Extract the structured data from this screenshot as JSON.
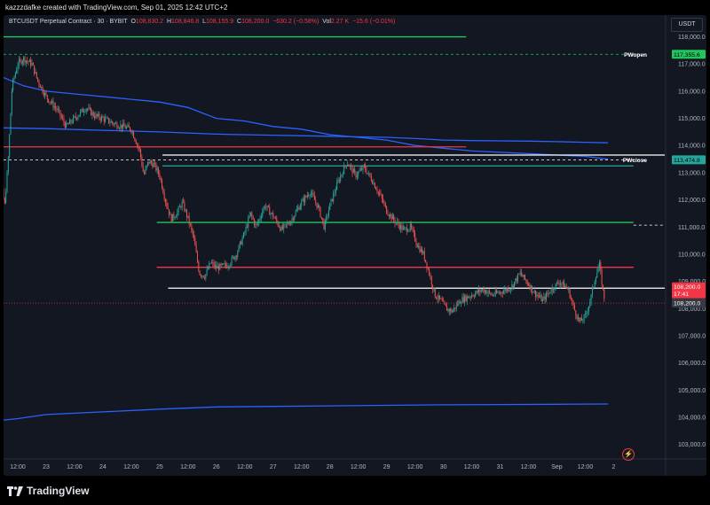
{
  "header": {
    "title": "kazzzdafke created with TradingView.com, Sep 01, 2025 12:42 UTC+2"
  },
  "legend": {
    "symbol": "BTCUSDT Perpetual Contract · 30 · BYBIT",
    "o_label": "O",
    "o": "108,830.2",
    "h_label": "H",
    "h": "108,846.8",
    "l_label": "L",
    "l": "108,155.9",
    "c_label": "C",
    "c": "108,200.0",
    "change": "−630.2 (−0.58%)",
    "vol_label": "Vol",
    "vol": "2.27 K",
    "vol_change": "−15.6 (−0.01%)"
  },
  "currency_button": "USDT",
  "footer": {
    "brand": "TradingView"
  },
  "colors": {
    "background": "#131722",
    "up": "#26a69a",
    "down": "#ef5350",
    "green_level": "#22c55e",
    "red_level": "#f23645",
    "blue_line": "#2962ff",
    "white_level": "#ffffff"
  },
  "chart_data": {
    "type": "candlestick",
    "interval": "30",
    "ylim": [
      102500,
      118800
    ],
    "y_ticks": [
      "118,000.0",
      "117,000.0",
      "116,000.0",
      "115,000.0",
      "114,000.0",
      "113,000.0",
      "112,000.0",
      "111,000.0",
      "110,000.0",
      "109,000.0",
      "108,000.0",
      "107,000.0",
      "106,000.0",
      "105,000.0",
      "104,000.0",
      "103,000.0"
    ],
    "y_tick_values": [
      118000,
      117000,
      116000,
      115000,
      114000,
      113000,
      112000,
      111000,
      110000,
      109000,
      108000,
      107000,
      106000,
      105000,
      104000,
      103000
    ],
    "x_ticks": [
      "12:00",
      "23",
      "12:00",
      "24",
      "12:00",
      "25",
      "12:00",
      "26",
      "12:00",
      "27",
      "12:00",
      "28",
      "12:00",
      "29",
      "12:00",
      "30",
      "12:00",
      "31",
      "12:00",
      "Sep",
      "12:00",
      "2"
    ],
    "x_range_days": [
      22.25,
      33.9
    ],
    "x_tick_values": [
      22.5,
      23,
      23.5,
      24,
      24.5,
      25,
      25.5,
      26,
      26.5,
      27,
      27.5,
      28,
      28.5,
      29,
      29.5,
      30,
      30.5,
      31,
      31.5,
      32,
      32.5,
      33
    ],
    "price_path": [
      [
        22.0,
        113500
      ],
      [
        22.1,
        113200
      ],
      [
        22.2,
        112600
      ],
      [
        22.27,
        111800
      ],
      [
        22.33,
        113400
      ],
      [
        22.4,
        116200
      ],
      [
        22.5,
        117000
      ],
      [
        22.6,
        117200
      ],
      [
        22.75,
        117000
      ],
      [
        22.85,
        116400
      ],
      [
        23.0,
        115800
      ],
      [
        23.2,
        115300
      ],
      [
        23.35,
        114700
      ],
      [
        23.5,
        115000
      ],
      [
        23.7,
        115400
      ],
      [
        23.85,
        115100
      ],
      [
        24.0,
        115000
      ],
      [
        24.2,
        114800
      ],
      [
        24.35,
        114700
      ],
      [
        24.5,
        114600
      ],
      [
        24.65,
        113800
      ],
      [
        24.72,
        112900
      ],
      [
        24.8,
        113400
      ],
      [
        24.9,
        113300
      ],
      [
        25.0,
        112900
      ],
      [
        25.1,
        112000
      ],
      [
        25.2,
        111300
      ],
      [
        25.3,
        111500
      ],
      [
        25.4,
        111900
      ],
      [
        25.5,
        111300
      ],
      [
        25.6,
        110600
      ],
      [
        25.7,
        109300
      ],
      [
        25.8,
        109200
      ],
      [
        25.9,
        109700
      ],
      [
        26.0,
        109500
      ],
      [
        26.2,
        109600
      ],
      [
        26.35,
        110000
      ],
      [
        26.5,
        110800
      ],
      [
        26.6,
        111500
      ],
      [
        26.7,
        111000
      ],
      [
        26.85,
        111800
      ],
      [
        27.0,
        111400
      ],
      [
        27.15,
        110900
      ],
      [
        27.3,
        111200
      ],
      [
        27.5,
        111900
      ],
      [
        27.65,
        112300
      ],
      [
        27.8,
        111700
      ],
      [
        27.9,
        111000
      ],
      [
        28.0,
        111800
      ],
      [
        28.15,
        112700
      ],
      [
        28.3,
        113400
      ],
      [
        28.45,
        112900
      ],
      [
        28.6,
        113200
      ],
      [
        28.75,
        112700
      ],
      [
        28.9,
        112100
      ],
      [
        29.0,
        111600
      ],
      [
        29.15,
        111200
      ],
      [
        29.3,
        110900
      ],
      [
        29.42,
        111000
      ],
      [
        29.55,
        110300
      ],
      [
        29.65,
        110000
      ],
      [
        29.75,
        109300
      ],
      [
        29.85,
        108500
      ],
      [
        29.95,
        108300
      ],
      [
        30.05,
        108000
      ],
      [
        30.15,
        107900
      ],
      [
        30.3,
        108300
      ],
      [
        30.5,
        108500
      ],
      [
        30.7,
        108700
      ],
      [
        30.85,
        108500
      ],
      [
        31.0,
        108600
      ],
      [
        31.2,
        108800
      ],
      [
        31.35,
        109300
      ],
      [
        31.5,
        108900
      ],
      [
        31.6,
        108600
      ],
      [
        31.75,
        108300
      ],
      [
        31.9,
        108700
      ],
      [
        32.05,
        109000
      ],
      [
        32.2,
        108700
      ],
      [
        32.3,
        108000
      ],
      [
        32.4,
        107500
      ],
      [
        32.5,
        107700
      ],
      [
        32.6,
        108400
      ],
      [
        32.68,
        109200
      ],
      [
        32.75,
        109600
      ],
      [
        32.8,
        108800
      ],
      [
        32.85,
        108200
      ]
    ],
    "horizontal_levels": [
      {
        "label": "",
        "y": 118000,
        "x_from": 22.25,
        "x_to": 30.4,
        "style": "solid",
        "color": "green"
      },
      {
        "label": "PWopen",
        "y": 117356.6,
        "x_from": 22.25,
        "x_to": 33.6,
        "style": "dashed",
        "color": "green"
      },
      {
        "label": "",
        "y": 113950,
        "x_from": 22.25,
        "x_to": 30.4,
        "style": "solid",
        "color": "red"
      },
      {
        "label": "PWclose",
        "y": 113474.8,
        "x_from": 22.25,
        "x_to": 33.6,
        "style": "dashed",
        "color": "white"
      },
      {
        "label": "",
        "y": 113650,
        "x_from": 25.05,
        "x_to": 33.9,
        "style": "solid",
        "color": "white"
      },
      {
        "label": "",
        "y": 113250,
        "x_from": 25.05,
        "x_to": 33.35,
        "style": "solid",
        "color": "teal"
      },
      {
        "label": "",
        "y": 111170,
        "x_from": 24.95,
        "x_to": 33.35,
        "style": "solid",
        "color": "green"
      },
      {
        "label": "",
        "y": 111070,
        "x_from": 33.35,
        "x_to": 33.9,
        "style": "dashed",
        "color": "white"
      },
      {
        "label": "",
        "y": 109520,
        "x_from": 24.95,
        "x_to": 33.35,
        "style": "solid",
        "color": "red"
      },
      {
        "label": "",
        "y": 108750,
        "x_from": 25.15,
        "x_to": 33.9,
        "style": "solid",
        "color": "white"
      },
      {
        "label": "",
        "y": 108200,
        "x_from": 22.25,
        "x_to": 33.9,
        "style": "dotted",
        "color": "red"
      }
    ],
    "blue_curves": [
      {
        "points": [
          [
            22.25,
            116500
          ],
          [
            22.6,
            116200
          ],
          [
            23.0,
            116000
          ],
          [
            23.5,
            115900
          ],
          [
            24.0,
            115800
          ],
          [
            24.5,
            115700
          ],
          [
            25.0,
            115600
          ],
          [
            25.5,
            115400
          ],
          [
            26.0,
            115000
          ],
          [
            26.5,
            114900
          ],
          [
            27.0,
            114700
          ],
          [
            27.5,
            114600
          ],
          [
            28.0,
            114400
          ],
          [
            28.5,
            114300
          ],
          [
            29.0,
            114200
          ],
          [
            29.5,
            114000
          ],
          [
            30.0,
            113900
          ],
          [
            30.5,
            113800
          ],
          [
            31.0,
            113750
          ],
          [
            31.5,
            113700
          ],
          [
            32.0,
            113650
          ],
          [
            32.5,
            113600
          ],
          [
            32.9,
            113500
          ]
        ]
      },
      {
        "points": [
          [
            22.25,
            114650
          ],
          [
            23.0,
            114620
          ],
          [
            24.0,
            114560
          ],
          [
            25.0,
            114500
          ],
          [
            26.0,
            114420
          ],
          [
            27.0,
            114380
          ],
          [
            28.0,
            114340
          ],
          [
            29.0,
            114300
          ],
          [
            29.6,
            114250
          ],
          [
            30.0,
            114200
          ],
          [
            30.5,
            114180
          ],
          [
            31.0,
            114170
          ],
          [
            31.5,
            114160
          ],
          [
            32.0,
            114140
          ],
          [
            32.5,
            114120
          ],
          [
            32.9,
            114100
          ]
        ]
      },
      {
        "points": [
          [
            22.25,
            103900
          ],
          [
            22.5,
            103950
          ],
          [
            23.0,
            104100
          ],
          [
            24.0,
            104200
          ],
          [
            25.0,
            104300
          ],
          [
            26.0,
            104380
          ],
          [
            27.0,
            104400
          ],
          [
            28.0,
            104420
          ],
          [
            29.0,
            104440
          ],
          [
            30.0,
            104460
          ],
          [
            31.0,
            104470
          ],
          [
            32.0,
            104480
          ],
          [
            32.9,
            104490
          ]
        ]
      }
    ],
    "price_labels": [
      {
        "text": "117,355.6",
        "y": 117355.6,
        "color": "green"
      },
      {
        "text": "113,474.8",
        "y": 113474.8,
        "color": "teal"
      },
      {
        "text": "108,200.0",
        "sub": "17:41",
        "y": 108800,
        "color": "red"
      },
      {
        "text": "108,200.0",
        "y": 108200,
        "color": "slate"
      }
    ]
  }
}
